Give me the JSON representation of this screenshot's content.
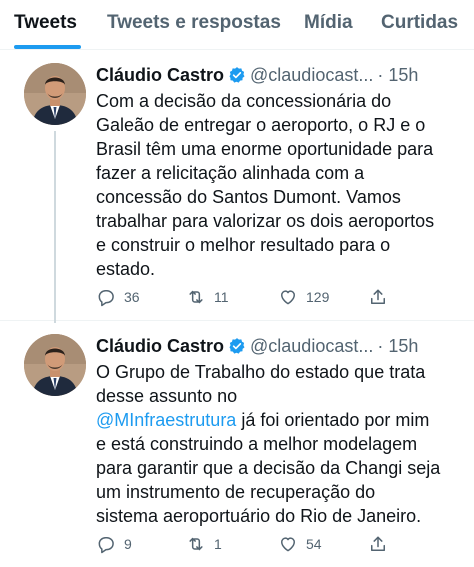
{
  "tabs": [
    "Tweets",
    "Tweets e respostas",
    "Mídia",
    "Curtidas"
  ],
  "colors": {
    "accent": "#1d9bf0",
    "secondary_text": "#536471",
    "primary_text": "#0f1419"
  },
  "tweets": [
    {
      "name": "Cláudio Castro",
      "handle": "@claudiocast...",
      "time": "· 15h",
      "lines": [
        "Com a decisão da concessionária do",
        "Galeão de entregar o aeroporto, o RJ e o",
        "Brasil têm uma enorme oportunidade para",
        "fazer a relicitação alinhada com a",
        "concessão do Santos Dumont. Vamos",
        "trabalhar para valorizar os dois aeroportos",
        "e construir o melhor resultado para o",
        "estado."
      ],
      "replies": "36",
      "retweets": "11",
      "likes": "129"
    },
    {
      "name": "Cláudio Castro",
      "handle": "@claudiocast...",
      "time": "· 15h",
      "lines_before_mention": [
        "O Grupo de Trabalho do estado que trata",
        "desse assunto no"
      ],
      "mention": "@MInfraestrutura",
      "mention_suffix": " já foi orientado por mim",
      "lines_after_mention": [
        "e está construindo a melhor modelagem",
        "para garantir que a decisão da Changi seja",
        "um instrumento de recuperação do",
        "sistema aeroportuário do Rio de Janeiro."
      ],
      "replies": "9",
      "retweets": "1",
      "likes": "54"
    }
  ]
}
